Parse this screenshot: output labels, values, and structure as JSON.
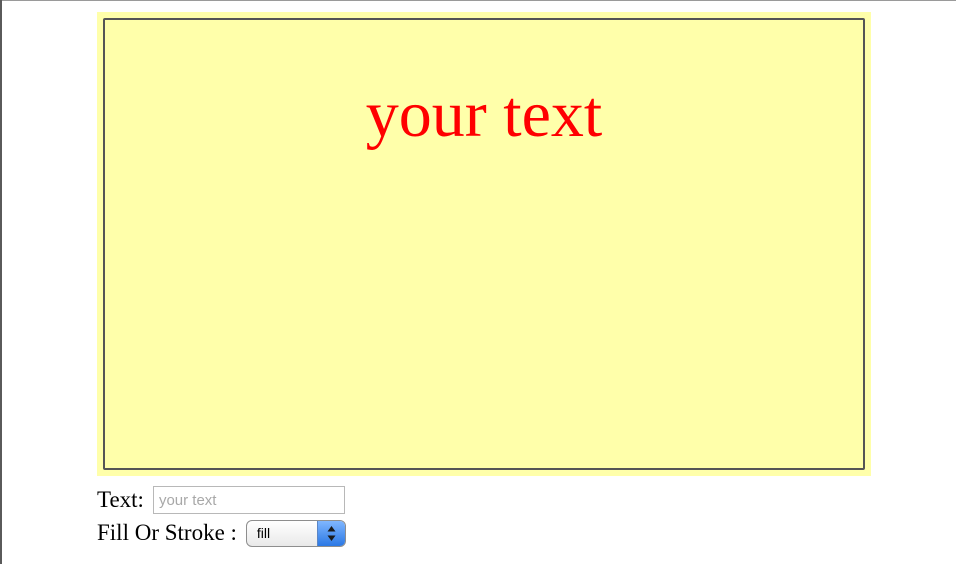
{
  "canvas": {
    "text": "your text",
    "text_color": "#ff0000",
    "background_color": "#ffffaa"
  },
  "controls": {
    "text_label": "Text:",
    "text_input_value": "",
    "text_input_placeholder": "your text",
    "fill_stroke_label": "Fill Or Stroke :",
    "fill_stroke_value": "fill",
    "fill_stroke_icon": "updown-arrows-icon"
  }
}
